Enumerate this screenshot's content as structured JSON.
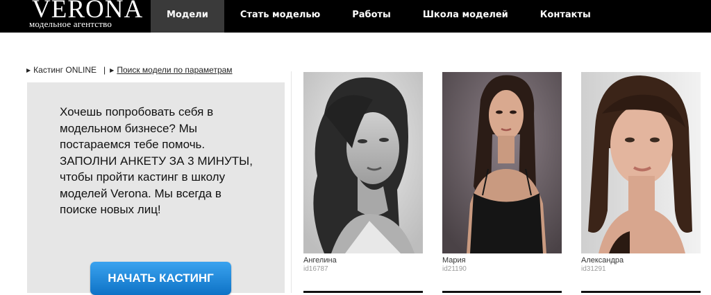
{
  "header": {
    "logo_title": "VERONA",
    "logo_subtitle": "модельное агентство",
    "nav": [
      {
        "label": "Модели",
        "active": true
      },
      {
        "label": "Стать моделью",
        "active": false
      },
      {
        "label": "Работы",
        "active": false
      },
      {
        "label": "Школа моделей",
        "active": false
      },
      {
        "label": "Контакты",
        "active": false
      }
    ]
  },
  "breadcrumbs": {
    "casting_online": "Кастинг ONLINE",
    "separator": "|",
    "search_params": "Поиск модели по параметрам"
  },
  "casting": {
    "text": "Хочешь попробовать себя в модельном бизнесе? Мы постараемся тебе помочь. ЗАПОЛНИ АНКЕТУ ЗА 3 МИНУТЫ, чтобы пройти кастинг в школу моделей Verona. Мы всегда в поиске новых лиц!",
    "button_label": "НАЧАТЬ КАСТИНГ",
    "button_color": "#1a86dd"
  },
  "models": [
    {
      "name": "Ангелина",
      "id": "id16787"
    },
    {
      "name": "Мария",
      "id": "id21190"
    },
    {
      "name": "Александра",
      "id": "id31291"
    }
  ]
}
